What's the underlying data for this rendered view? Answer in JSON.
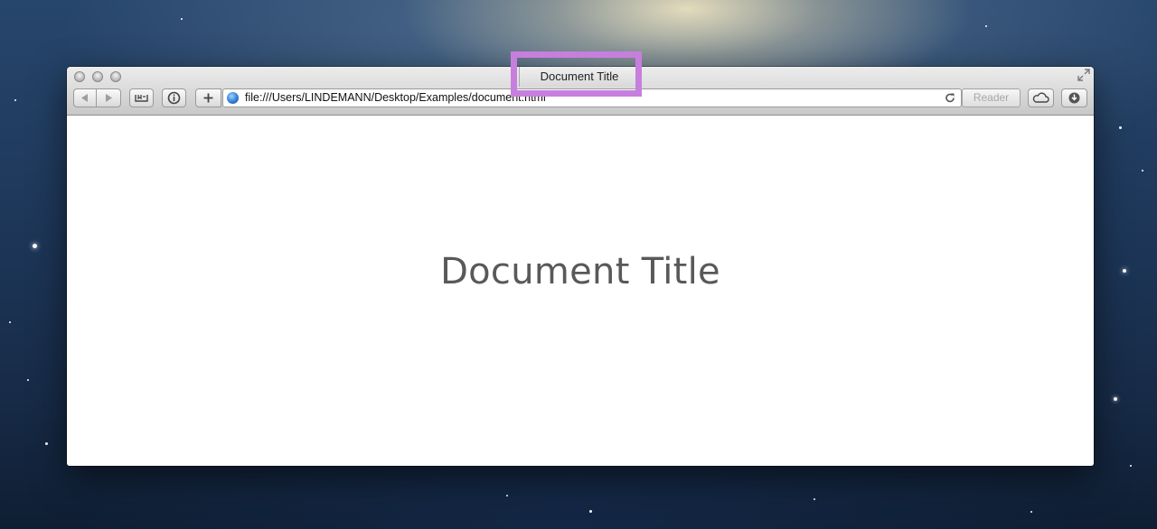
{
  "browser": {
    "window_title": "Document Title",
    "url": "file:///Users/LINDEMANN/Desktop/Examples/document.html",
    "reader_label": "Reader",
    "icons": {
      "back": "back-arrow-icon",
      "forward": "forward-arrow-icon",
      "bookmarks": "bookmarks-icon",
      "info": "info-icon",
      "new_tab": "plus-icon",
      "site": "globe-icon",
      "reload": "reload-icon",
      "icloud": "cloud-icon",
      "downloads": "download-icon",
      "fullscreen": "fullscreen-icon"
    }
  },
  "page": {
    "heading": "Document Title"
  },
  "colors": {
    "highlight": "#c77fdd",
    "heading_text": "#595959"
  }
}
